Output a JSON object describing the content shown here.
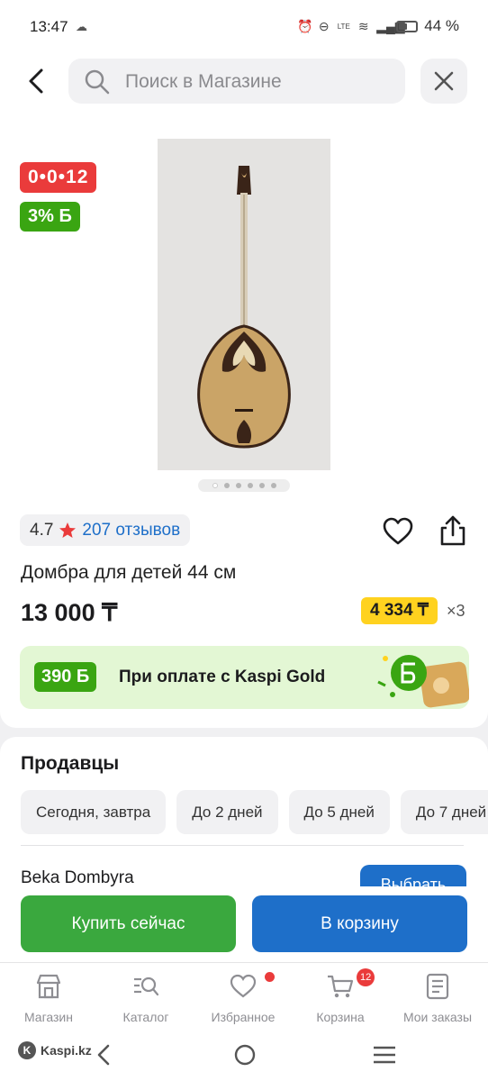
{
  "status_bar": {
    "time": "13:47",
    "battery": "44 %"
  },
  "search": {
    "placeholder": "Поиск в Магазине"
  },
  "product": {
    "badge_timer": "0•0•12",
    "badge_bonus": "3% Б",
    "photo_count": 6,
    "active_photo": 1,
    "rating": "4.7",
    "reviews": "207 отзывов",
    "title": "Домбра для детей 44 см",
    "price": "13 000 ₸",
    "installment_price": "4 334 ₸",
    "installment_months": "×3"
  },
  "gold_banner": {
    "bonus": "390 Б",
    "text": "При оплате с Kaspi Gold"
  },
  "sellers": {
    "title": "Продавцы",
    "delivery_chips": [
      "Сегодня, завтра",
      "До 2 дней",
      "До 5 дней",
      "До 7 дней"
    ],
    "seller_name": "Beka Dombyra",
    "choose_label": "Выбрать"
  },
  "actions": {
    "buy_now": "Купить сейчас",
    "to_cart": "В корзину"
  },
  "tabs": [
    {
      "label": "Магазин",
      "icon": "shop-icon"
    },
    {
      "label": "Каталог",
      "icon": "catalog-icon"
    },
    {
      "label": "Избранное",
      "icon": "heart-icon"
    },
    {
      "label": "Корзина",
      "icon": "cart-icon",
      "badge": "12"
    },
    {
      "label": "Мои заказы",
      "icon": "orders-icon"
    }
  ],
  "brand": "Kaspi.kz",
  "colors": {
    "accent_blue": "#1e6fc9",
    "accent_green": "#3aa83e",
    "promo_red": "#ea3b3b",
    "installment_yellow": "#ffd21f"
  }
}
